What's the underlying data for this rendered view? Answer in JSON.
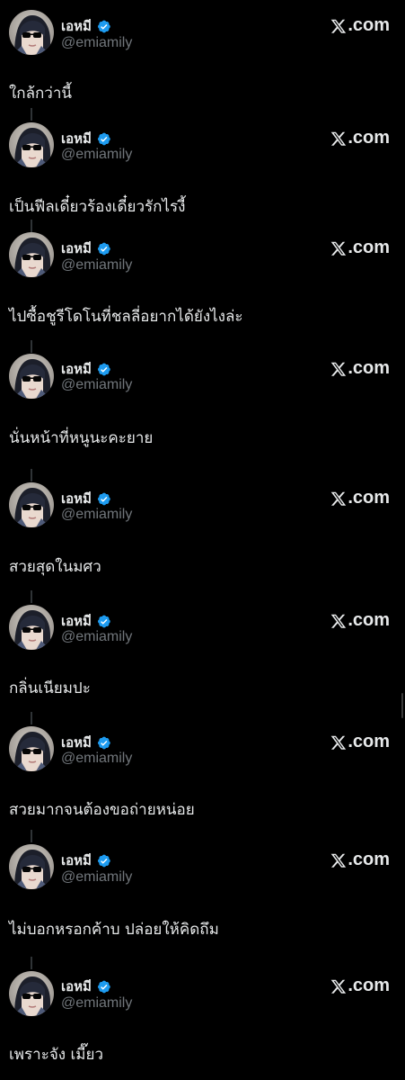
{
  "author": {
    "display_name": "เอหมี",
    "handle": "@emiamily",
    "avatar_icon": "avatar-sunglasses-portrait",
    "verified_icon": "verified-badge-icon",
    "verified_color": "#1d9bf0"
  },
  "source": {
    "icon": "x-logo-icon",
    "label": ".com"
  },
  "posts": [
    {
      "text": "ใกล้กว่านี้"
    },
    {
      "text": "เป็นฟีลเดี๋ยวร้องเดี๋ยวรักไรงี้"
    },
    {
      "text": "ไปซื้อชูรีโดโนที่ชลลี่อยากได้ยังไงล่ะ"
    },
    {
      "text": "นั่นหน้าที่หนูนะคะยาย"
    },
    {
      "text": "สวยสุดในมศว"
    },
    {
      "text": "กลิ่นเนียมปะ"
    },
    {
      "text": "สวยมากจนต้องขอถ่ายหน่อย"
    },
    {
      "text": "ไม่บอกหรอกค้าบ ปล่อยให้คิดถึม"
    },
    {
      "text": "เพราะจัง เมี๊ยว"
    }
  ]
}
